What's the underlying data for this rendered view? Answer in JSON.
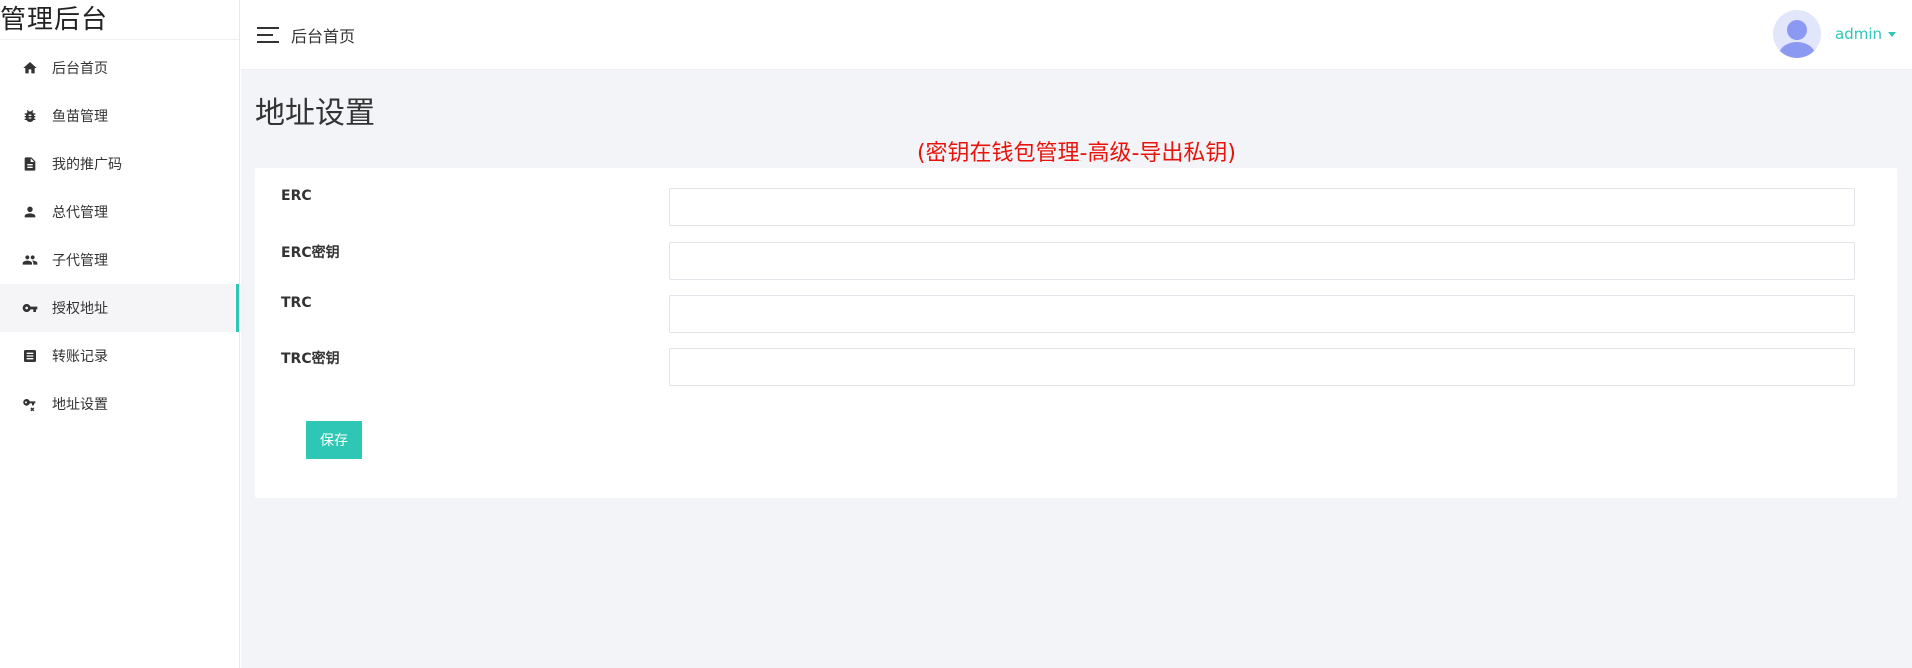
{
  "brand": {
    "title": "管理后台"
  },
  "sidebar": {
    "items": [
      {
        "label": "后台首页",
        "icon": "home-icon"
      },
      {
        "label": "鱼苗管理",
        "icon": "bug-icon"
      },
      {
        "label": "我的推广码",
        "icon": "document-icon"
      },
      {
        "label": "总代管理",
        "icon": "person-icon"
      },
      {
        "label": "子代管理",
        "icon": "people-icon"
      },
      {
        "label": "授权地址",
        "icon": "key-icon",
        "active": true
      },
      {
        "label": "转账记录",
        "icon": "receipt-icon"
      },
      {
        "label": "地址设置",
        "icon": "key-settings-icon"
      }
    ]
  },
  "topbar": {
    "breadcrumb": "后台首页"
  },
  "user": {
    "name": "admin"
  },
  "page": {
    "title": "地址设置",
    "notice": "(密钥在钱包管理-高级-导出私钥)"
  },
  "form": {
    "fields": [
      {
        "label": "ERC",
        "value": ""
      },
      {
        "label": "ERC密钥",
        "value": ""
      },
      {
        "label": "TRC",
        "value": ""
      },
      {
        "label": "TRC密钥",
        "value": ""
      }
    ],
    "save_label": "保存"
  },
  "colors": {
    "accent": "#2ec7b6",
    "notice": "#e8140c",
    "background": "#f3f4f8"
  }
}
